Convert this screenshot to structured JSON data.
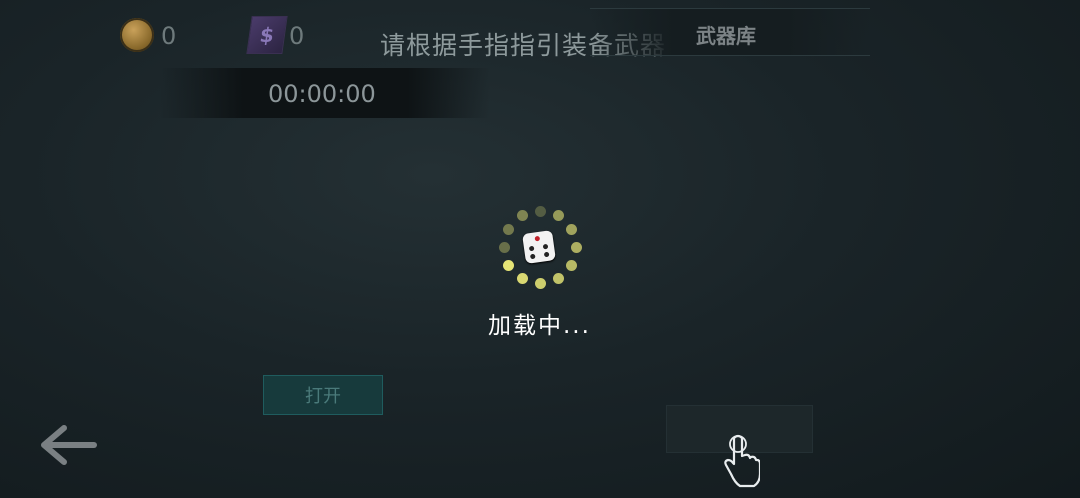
{
  "currency": {
    "coin_icon": "coin-icon",
    "coin_count": "0",
    "gem_icon": "gem-icon",
    "gem_count": "0"
  },
  "hint": "请根据手指指引装备武器",
  "armory": {
    "label": "武器库"
  },
  "timer": "00:00:00",
  "loading": {
    "text": "加载中...",
    "spinner_color": "#f0ee7a",
    "icon": "dice-icon"
  },
  "open_button": {
    "label": "打开"
  },
  "nav": {
    "back_icon": "back-arrow-icon"
  },
  "guide": {
    "icon": "pointing-hand-icon"
  },
  "colors": {
    "accent_teal": "#173a3c",
    "spinner_yellow": "#f0ee7a"
  }
}
